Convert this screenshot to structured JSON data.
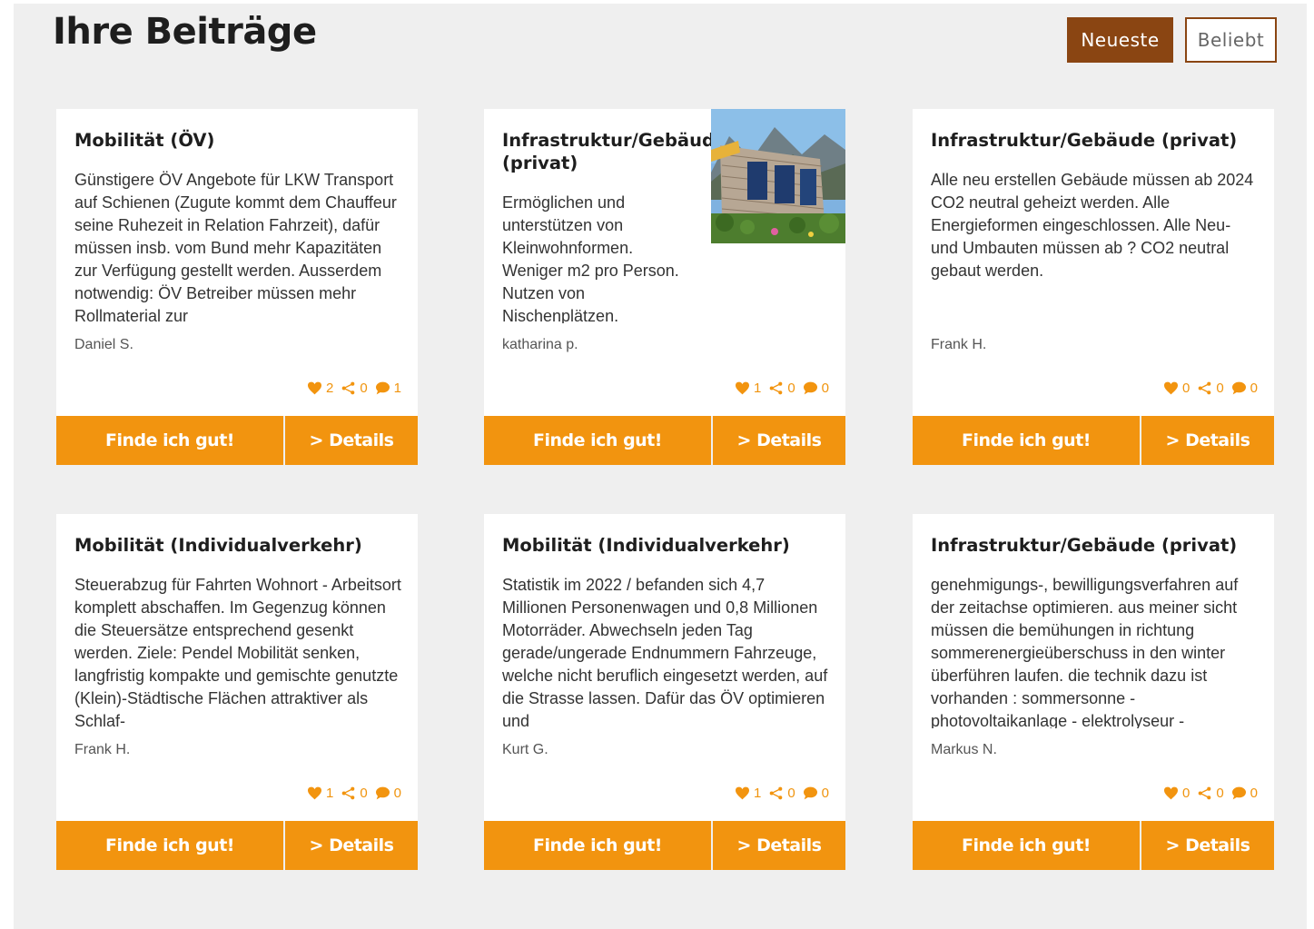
{
  "header": {
    "title": "Ihre Beiträge",
    "sort_newest": "Neueste",
    "sort_popular": "Beliebt"
  },
  "colors": {
    "accent": "#f2940f",
    "brand_brown": "#8a4512",
    "background": "#efefef"
  },
  "icons": {
    "likes": "heart-icon",
    "shares": "share-icon",
    "comments": "comment-icon"
  },
  "cards": [
    {
      "category": "Mobilität (ÖV)",
      "text": "Günstigere ÖV Angebote für LKW Transport auf Schienen (Zugute kommt dem Chauffeur seine Ruhezeit in Relation Fahrzeit), dafür müssen insb. vom Bund mehr Kapazitäten zur Verfügung gestellt werden. Ausserdem notwendig: ÖV Betreiber müssen mehr Rollmaterial zur",
      "author": "Daniel S.",
      "likes": "2",
      "shares": "0",
      "comments": "1",
      "like_label": "Finde ich gut!",
      "details_label": "> Details"
    },
    {
      "category": "Infrastruktur/Gebäude (privat)",
      "text": "Ermöglichen und unterstützen von Kleinwohnformen. Weniger m2 pro Person. Nutzen von Nischenplätzen.",
      "author": "katharina p.",
      "likes": "1",
      "shares": "0",
      "comments": "0",
      "like_label": "Finde ich gut!",
      "details_label": "> Details"
    },
    {
      "category": "Infrastruktur/Gebäude (privat)",
      "text": "Alle neu erstellen Gebäude müssen ab 2024 CO2 neutral geheizt werden. Alle Energieformen eingeschlossen. Alle Neu- und Umbauten müssen ab ? CO2 neutral gebaut werden.",
      "author": "Frank H.",
      "likes": "0",
      "shares": "0",
      "comments": "0",
      "like_label": "Finde ich gut!",
      "details_label": "> Details"
    },
    {
      "category": "Mobilität (Individualverkehr)",
      "text": "Steuerabzug für Fahrten Wohnort - Arbeitsort komplett abschaffen. Im Gegenzug können die Steuersätze entsprechend gesenkt werden. Ziele: Pendel Mobilität senken, langfristig kompakte und gemischte genutzte (Klein)-Städtische Flächen attraktiver als Schlaf-",
      "author": "Frank H.",
      "likes": "1",
      "shares": "0",
      "comments": "0",
      "like_label": "Finde ich gut!",
      "details_label": "> Details"
    },
    {
      "category": "Mobilität (Individualverkehr)",
      "text": "Statistik im 2022 / befanden sich 4,7 Millionen Personenwagen und 0,8 Millionen Motorräder. Abwechseln jeden Tag gerade/ungerade Endnummern Fahrzeuge, welche nicht beruflich eingesetzt werden, auf die Strasse lassen. Dafür das ÖV optimieren und",
      "author": "Kurt G.",
      "likes": "1",
      "shares": "0",
      "comments": "0",
      "like_label": "Finde ich gut!",
      "details_label": "> Details"
    },
    {
      "category": "Infrastruktur/Gebäude (privat)",
      "text": "genehmigungs-, bewilligungsverfahren auf der zeitachse optimieren. aus meiner sicht müssen die bemühungen in richtung sommerenergieüberschuss in den winter überführen laufen. die technik dazu ist vorhanden : sommersonne - photovoltaikanlage - elektrolyseur -",
      "author": "Markus N.",
      "likes": "0",
      "shares": "0",
      "comments": "0",
      "like_label": "Finde ich gut!",
      "details_label": "> Details"
    }
  ]
}
